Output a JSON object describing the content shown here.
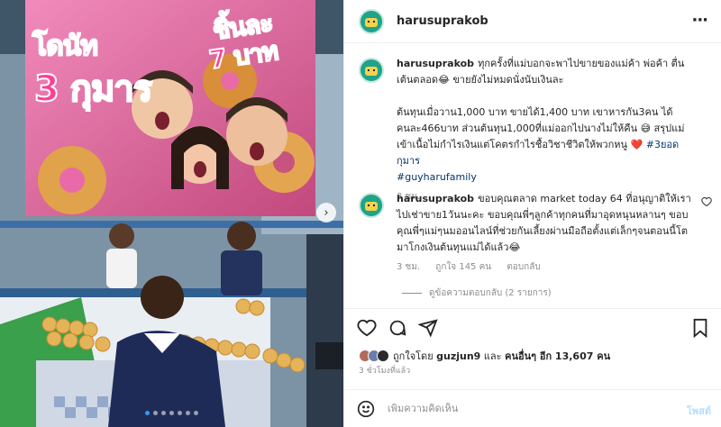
{
  "banner": {
    "line1": "โดนัท",
    "line2": "3 กุมาร",
    "line3": "ชิ้นละ",
    "line4": "7 บาท"
  },
  "header": {
    "username": "harusuprakob",
    "more_icon": "more-horizontal-icon"
  },
  "caption": {
    "username": "harusuprakob",
    "para1": "ทุกครั้งที่แม่บอกจะพาไปขายของแม่ค้า พ่อค้า ตื่นเต้นตลอด😂 ขายยังไม่หมดนั่งนับเงินละ",
    "para2": "ต้นทุนเมื่อวาน1,000 บาท ขายได้1,400 บาท เขาหารกัน3คน ได้คนละ466บาท ส่วนต้นทุน1,000ที่แม่ออกไปนางไม่ให้คืน 😅 สรุปแม่เข้าเนื้อไม่กำไรเงินแต่โคตรกำไรชื้อวิชาชีวิตให้พวกหนู ❤️",
    "hashtag1": "#3ยอดกุมาร",
    "hashtag2": "#guyharufamily",
    "time": "3 ชม."
  },
  "comment": {
    "username": "harusuprakob",
    "text": "ขอบคุณตลาด market today 64 ที่อนุญาติให้เราไปเช่าขาย1วันนะคะ ขอบคุณพี่ๆลูกค้าทุกคนที่มาอุดหนุนหลานๆ ขอบคุณพี่ๆแม่ๆนมออนไลน์ที่ช่วยกันเลี้ยงผ่านมือถือตั้งแต่เล็กๆจนตอนนี้โตมาโกงเงินต้นทุนแม่ได้แล้ว😂",
    "time": "3 ชม.",
    "likes": "ถูกใจ 145 คน",
    "reply": "ตอบกลับ",
    "view_replies": "ดูข้อความตอบกลับ (2 รายการ)"
  },
  "likes": {
    "prefix": "ถูกใจโดย",
    "user": "guzjun9",
    "mid": "และ",
    "others": "คนอื่นๆ อีก 13,607 คน"
  },
  "post_time": "3 ชั่วโมงที่แล้ว",
  "add_comment": {
    "placeholder": "เพิ่มความคิดเห็น",
    "post_label": "โพสต์"
  },
  "colors": {
    "link": "#00376b",
    "post_button": "#b2dffc",
    "active_dot": "#3897f0"
  },
  "icons": [
    "heart-icon",
    "comment-icon",
    "share-icon",
    "bookmark-icon",
    "emoji-icon",
    "chevron-right-icon"
  ]
}
